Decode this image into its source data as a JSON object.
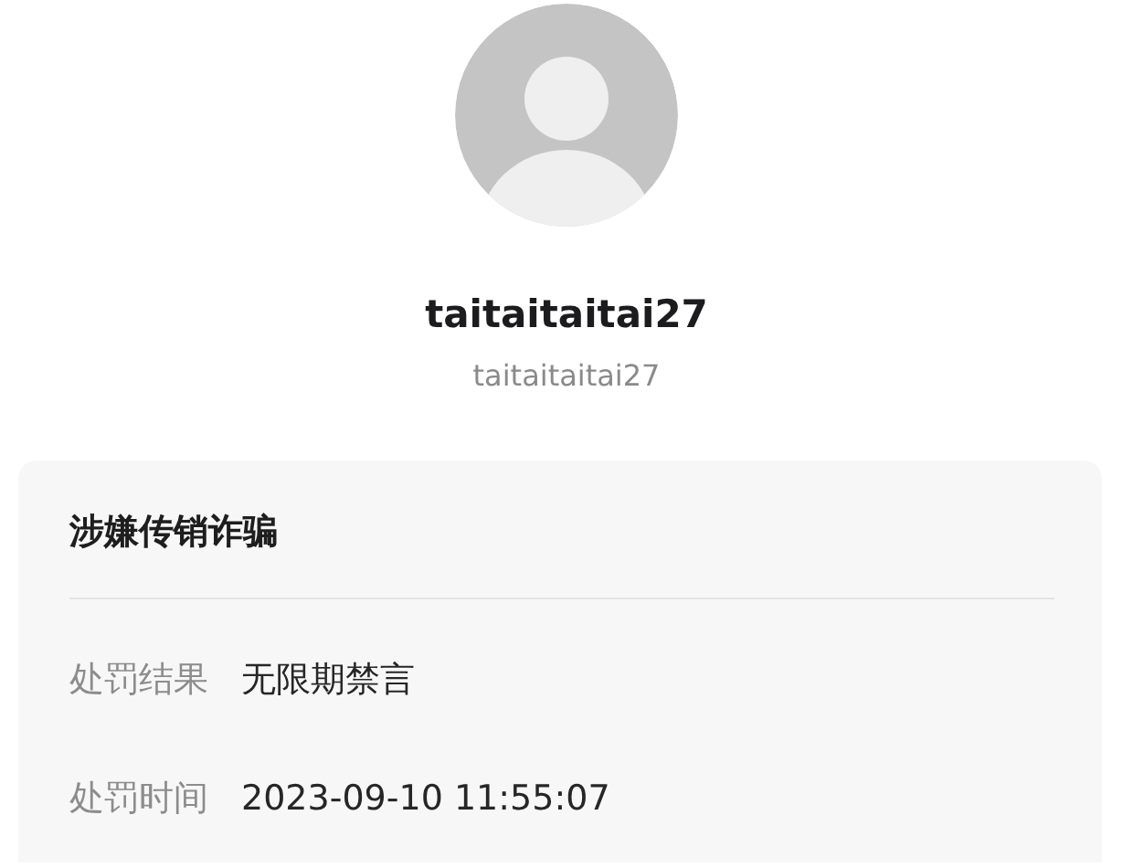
{
  "profile": {
    "display_name": "taitaitaitai27",
    "username": "taitaitaitai27"
  },
  "penalty": {
    "title": "涉嫌传销诈骗",
    "rows": [
      {
        "label": "处罚结果",
        "value": "无限期禁言"
      },
      {
        "label": "处罚时间",
        "value": "2023-09-10 11:55:07"
      }
    ]
  }
}
